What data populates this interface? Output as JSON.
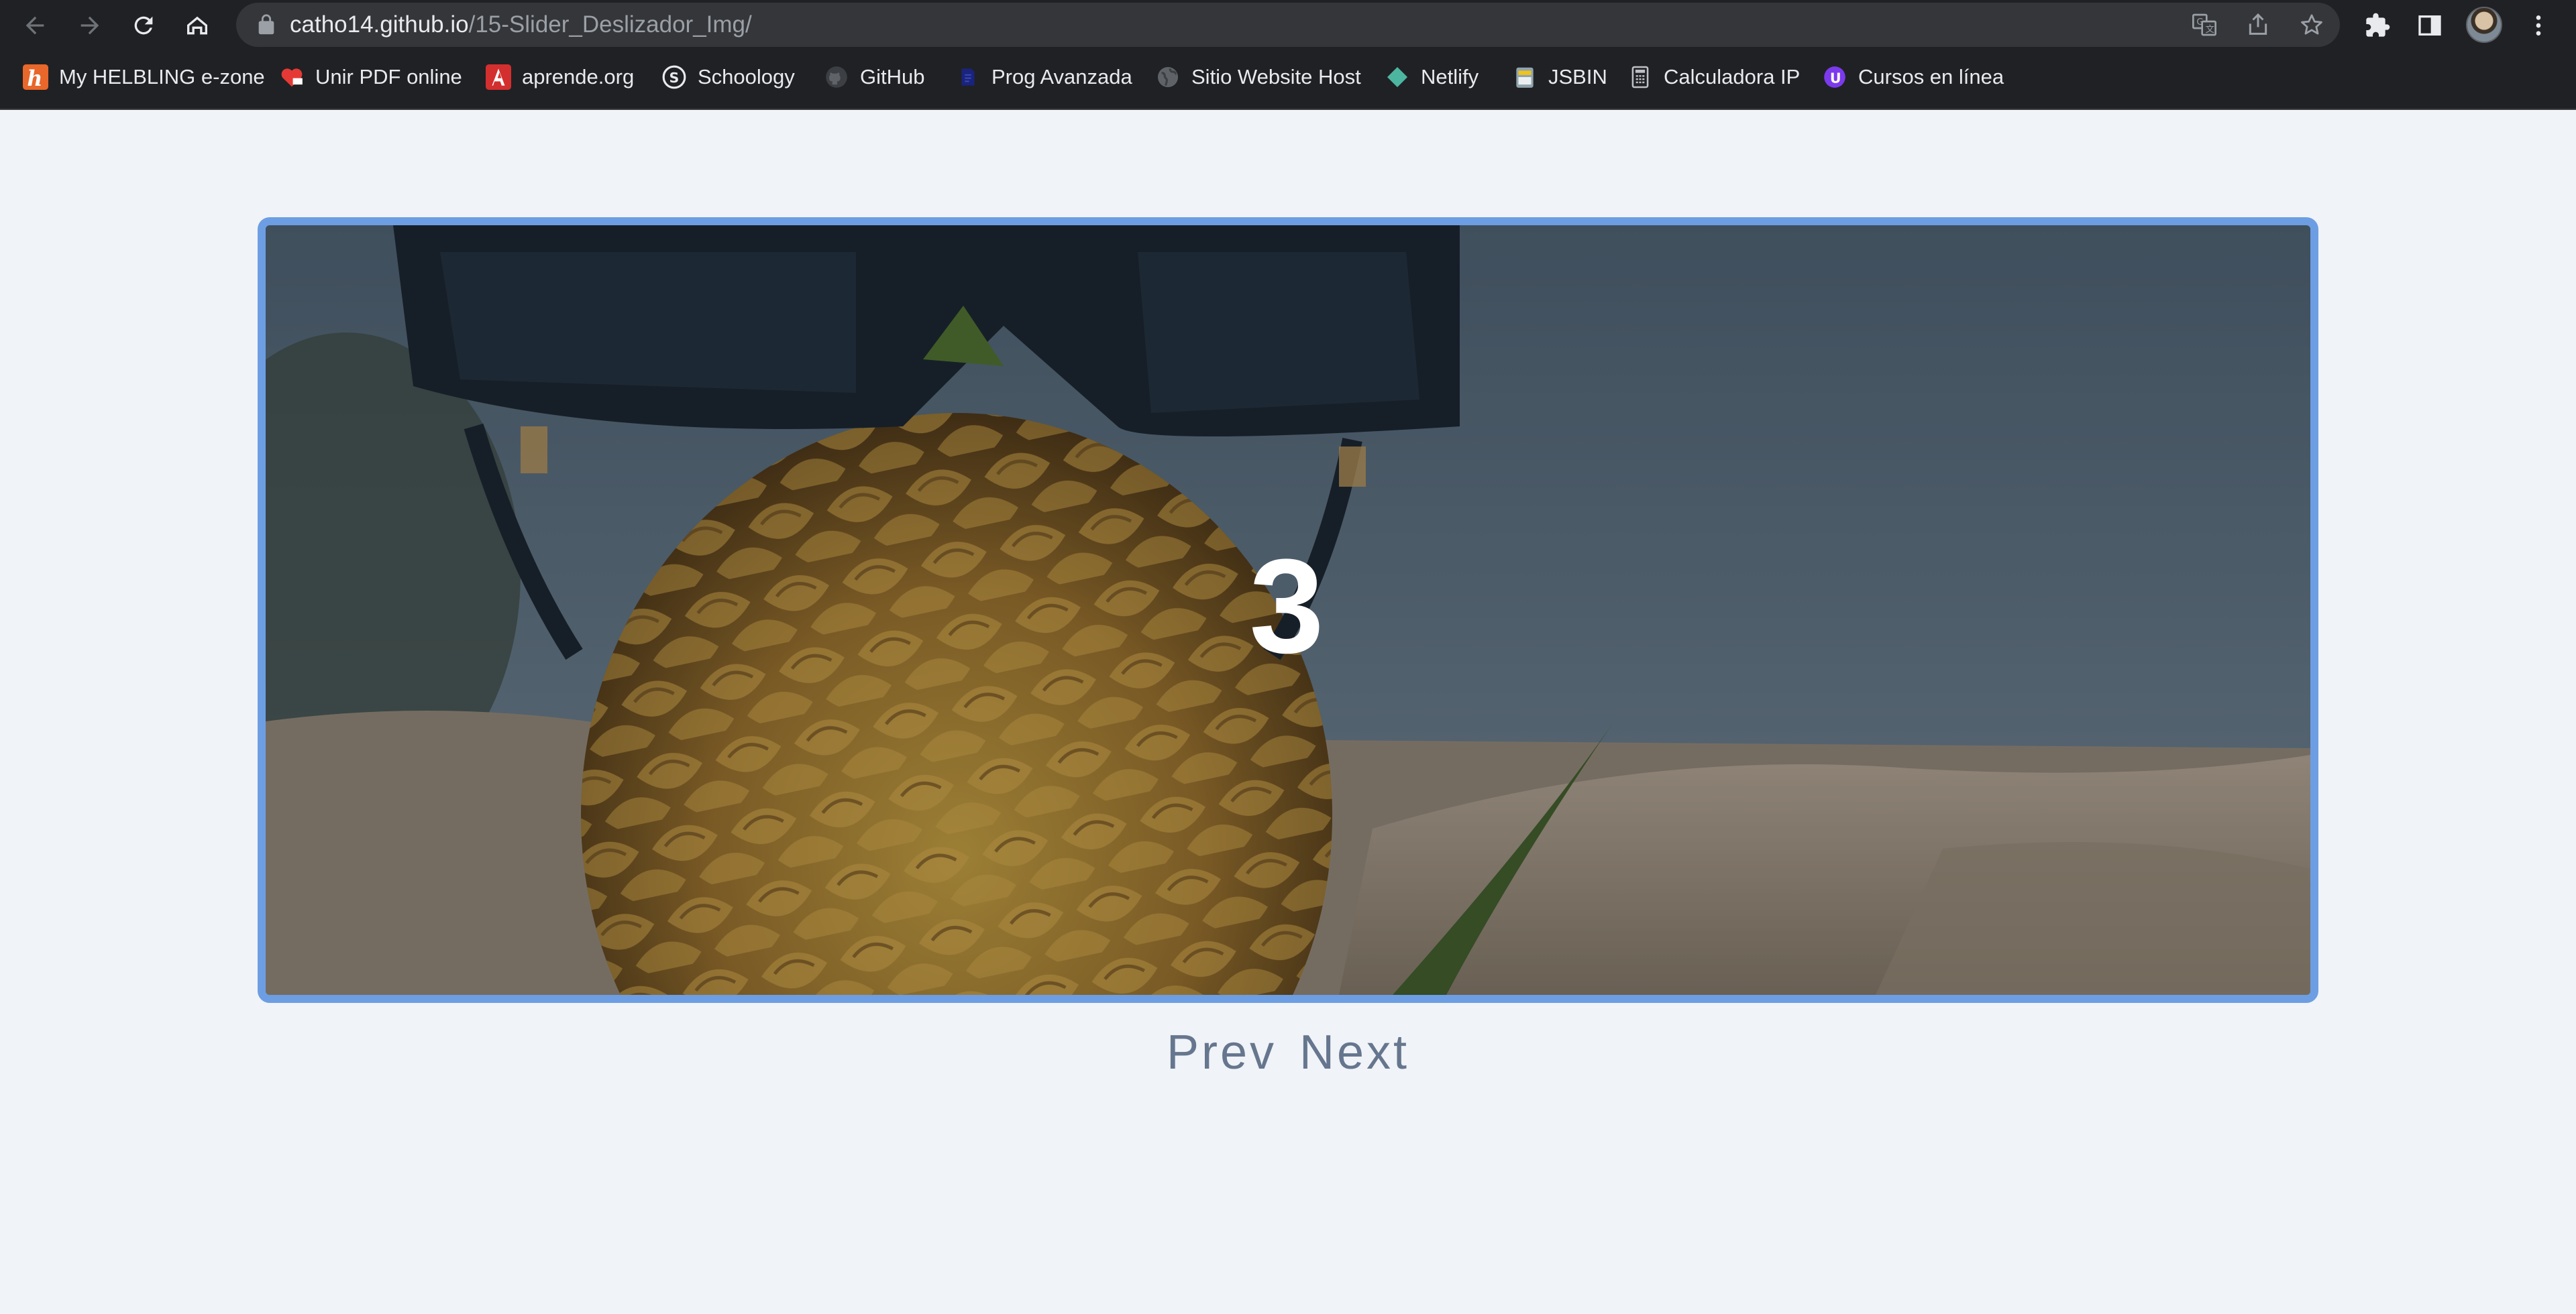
{
  "browser": {
    "url_host": "catho14.github.io",
    "url_path": "/15-Slider_Deslizador_Img/",
    "bookmarks": [
      {
        "label": "My HELBLING e-zone",
        "icon": "helbling-icon"
      },
      {
        "label": "Unir PDF online",
        "icon": "heart-pdf-icon"
      },
      {
        "label": "aprende.org",
        "icon": "aprende-icon"
      },
      {
        "label": "Schoology",
        "icon": "schoology-icon"
      },
      {
        "label": "GitHub",
        "icon": "github-icon"
      },
      {
        "label": "Prog Avanzada",
        "icon": "prog-avanzada-icon"
      },
      {
        "label": "Sitio Website Host",
        "icon": "globe-icon"
      },
      {
        "label": "Netlify",
        "icon": "netlify-icon"
      },
      {
        "label": "JSBIN",
        "icon": "jsbin-icon"
      },
      {
        "label": "Calculadora IP",
        "icon": "calculator-icon"
      },
      {
        "label": "Cursos en línea",
        "icon": "cursos-icon"
      }
    ]
  },
  "slider": {
    "current_slide": "3",
    "image": "pineapple-with-sunglasses-on-beach"
  },
  "controls": {
    "prev_label": "Prev",
    "next_label": "Next"
  },
  "colors": {
    "page_background": "#f0f3f7",
    "slider_border": "#6d9ee3",
    "control_text": "#66768e",
    "chrome_background": "#202124"
  }
}
